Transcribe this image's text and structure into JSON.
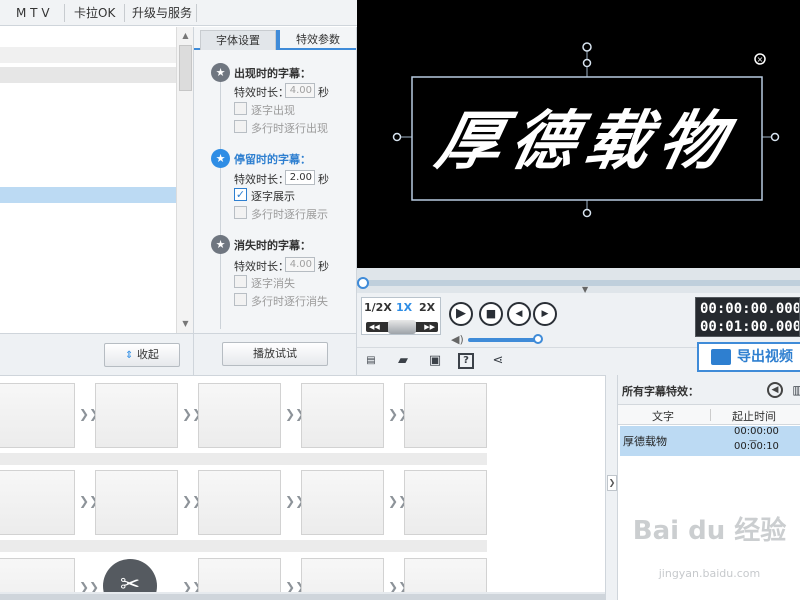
{
  "menu": {
    "items": [
      "M T V",
      "卡拉OK",
      "升级与服务"
    ]
  },
  "effects": {
    "tabs": [
      "字体设置",
      "特效参数"
    ],
    "appear": {
      "title": "出现时的字幕：",
      "duration_label": "特效时长：",
      "duration": "4.00",
      "unit": "秒",
      "options": [
        "逐字出现",
        "多行时逐行出现"
      ]
    },
    "stay": {
      "title": "停留时的字幕：",
      "duration_label": "特效时长：",
      "duration": "2.00",
      "unit": "秒",
      "options": [
        "逐字展示",
        "多行时逐行展示"
      ]
    },
    "vanish": {
      "title": "消失时的字幕：",
      "duration_label": "特效时长：",
      "duration": "4.00",
      "unit": "秒",
      "options": [
        "逐字消失",
        "多行时逐行消失"
      ]
    }
  },
  "buttons": {
    "collapse": "收起",
    "preview_play": "播放试试"
  },
  "preview": {
    "text": "厚德载物",
    "speeds": [
      "1/2X",
      "1X",
      "2X"
    ],
    "time_current": "00:00:00.000",
    "time_total": "00:01:00.000",
    "progress": 0.0,
    "volume": 0.9
  },
  "toolbar": {
    "export_label": "导出视频"
  },
  "subtitles": {
    "title": "所有字幕特效：",
    "col_text": "文字",
    "col_time": "起止时间",
    "rows": [
      {
        "text": "厚德载物",
        "start": "00:00:00",
        "end": "00:00:10"
      }
    ]
  },
  "watermark": {
    "logo": "Bai du 经验",
    "url": "jingyan.baidu.com"
  },
  "colors": {
    "accent": "#2e8de5",
    "selection": "#bcdaf3",
    "preview_bg": "#000000"
  }
}
